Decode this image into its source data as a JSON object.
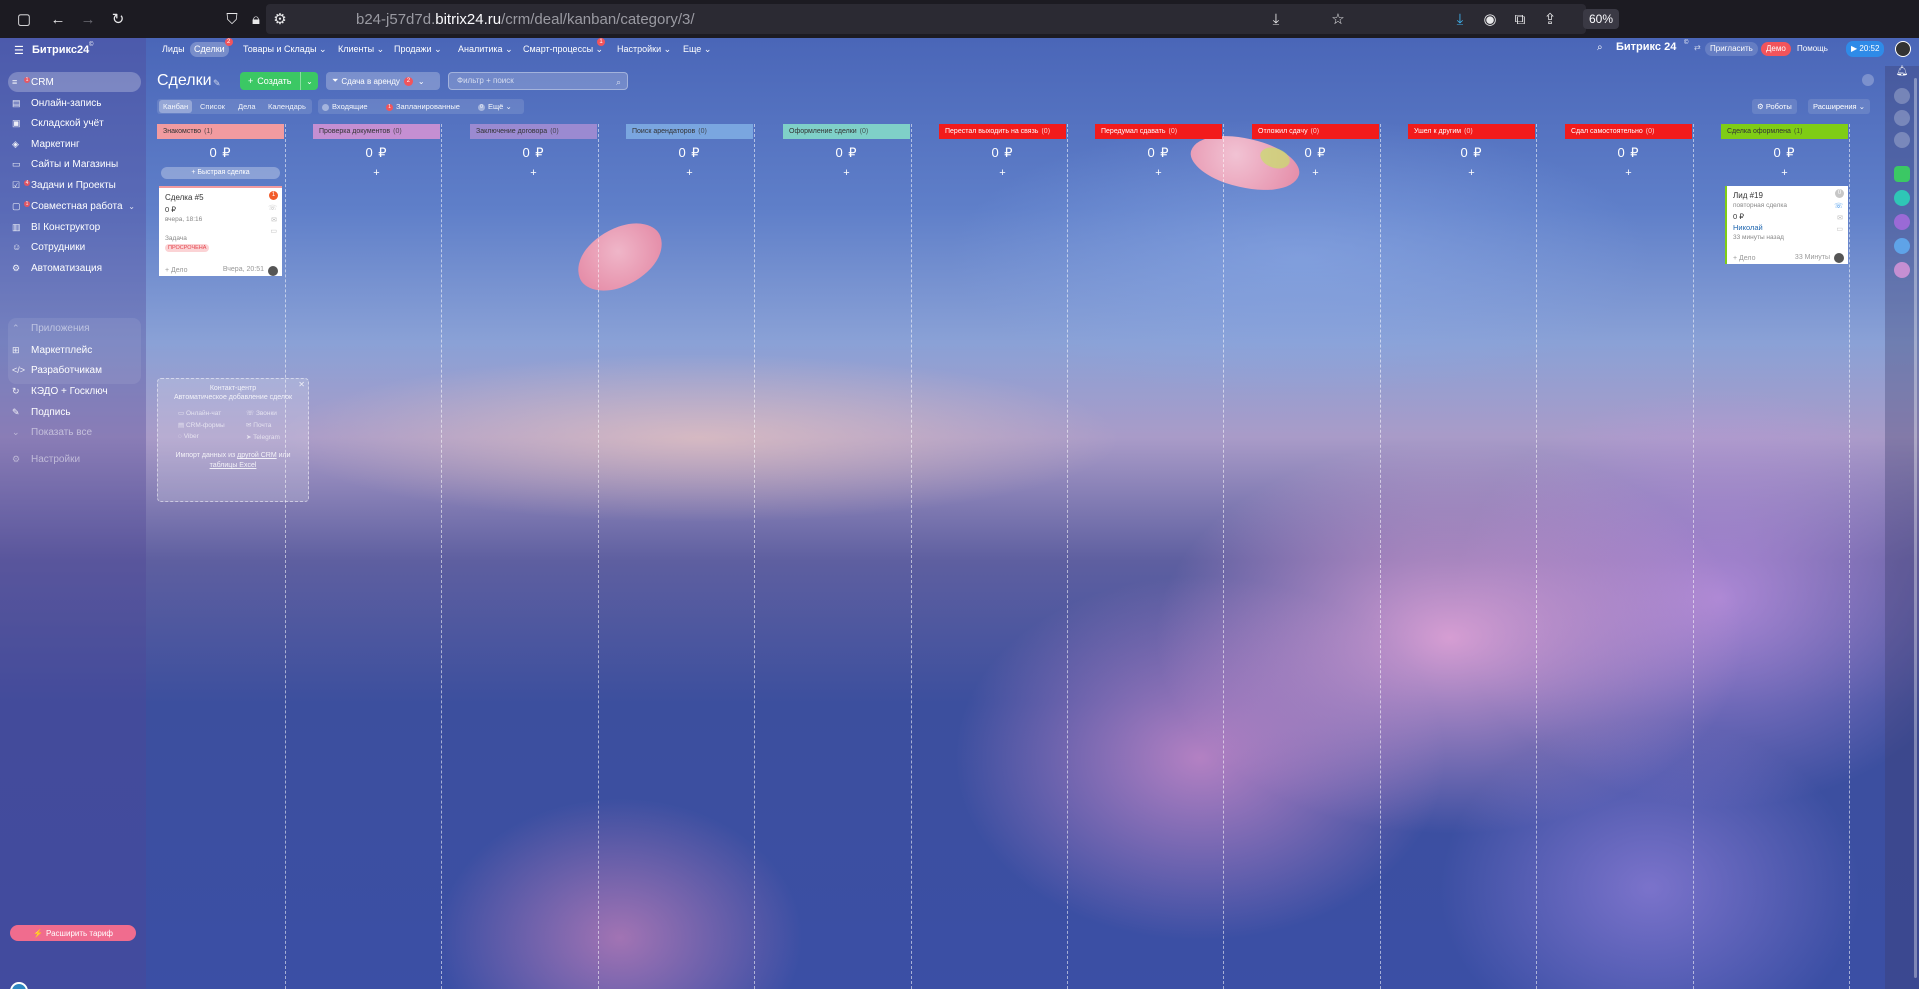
{
  "browser": {
    "url_host": "b24-j57d7d.",
    "url_domain": "bitrix24.ru",
    "url_path": "/crm/deal/kanban/category/3/",
    "zoom": "60%"
  },
  "sidebar": {
    "logo": "Битрикс24",
    "items": [
      {
        "label": "CRM",
        "badge": "1"
      },
      {
        "label": "Онлайн-запись"
      },
      {
        "label": "Складской учёт"
      },
      {
        "label": "Маркетинг"
      },
      {
        "label": "Сайты и Магазины"
      },
      {
        "label": "Задачи и Проекты",
        "badge": "4"
      },
      {
        "label": "Совместная работа",
        "badge": "1"
      },
      {
        "label": "BI Конструктор"
      },
      {
        "label": "Сотрудники"
      },
      {
        "label": "Автоматизация"
      },
      {
        "label": "Приложения"
      },
      {
        "label": "Маркетплейс"
      },
      {
        "label": "Разработчикам"
      },
      {
        "label": "КЭДО + Госключ"
      },
      {
        "label": "Подпись"
      },
      {
        "label": "Показать все"
      },
      {
        "label": "Настройки"
      }
    ],
    "upgrade": "Расширить тариф"
  },
  "topnav": {
    "items": [
      "Лиды",
      "Сделки",
      "Товары и Склады",
      "Клиенты",
      "Продажи",
      "Аналитика",
      "Смарт-процессы",
      "Настройки",
      "Еще"
    ],
    "deals_badge": "2",
    "smart_badge": "1",
    "brand": "Битрикс 24",
    "invite": "Пригласить",
    "demo": "Демо",
    "help": "Помощь",
    "clock": "20:52"
  },
  "toolbar": {
    "title": "Сделки",
    "create": "Создать",
    "pipeline": "Сдача в аренду",
    "pipeline_badge": "2",
    "filter_placeholder": "Фильтр + поиск",
    "views": [
      "Канбан",
      "Список",
      "Дела",
      "Календарь"
    ],
    "counters": {
      "incoming": "Входящие",
      "planned_badge": "1",
      "planned": "Запланированные",
      "more_badge": "0",
      "more": "Ещё"
    },
    "robots": "Роботы",
    "extensions": "Расширения"
  },
  "stages": [
    {
      "name": "Знакомство",
      "count": "(1)",
      "sum": "0 ₽",
      "color": "#f29ba0"
    },
    {
      "name": "Проверка документов",
      "count": "(0)",
      "sum": "0 ₽",
      "color": "#c58fd2"
    },
    {
      "name": "Заключение договора",
      "count": "(0)",
      "sum": "0 ₽",
      "color": "#9b8ad1"
    },
    {
      "name": "Поиск арендаторов",
      "count": "(0)",
      "sum": "0 ₽",
      "color": "#7aa6e0"
    },
    {
      "name": "Оформление сделки",
      "count": "(0)",
      "sum": "0 ₽",
      "color": "#7fd0c8"
    },
    {
      "name": "Перестал выходить на связь",
      "count": "(0)",
      "sum": "0 ₽",
      "color": "#f21b1b"
    },
    {
      "name": "Передумал сдавать",
      "count": "(0)",
      "sum": "0 ₽",
      "color": "#f21b1b"
    },
    {
      "name": "Отложил сдачу",
      "count": "(0)",
      "sum": "0 ₽",
      "color": "#f21b1b"
    },
    {
      "name": "Ушел к другим",
      "count": "(0)",
      "sum": "0 ₽",
      "color": "#f21b1b"
    },
    {
      "name": "Сдал самостоятельно",
      "count": "(0)",
      "sum": "0 ₽",
      "color": "#f21b1b"
    },
    {
      "name": "Сделка оформлена",
      "count": "(1)",
      "sum": "0 ₽",
      "color": "#7fcd15"
    }
  ],
  "quick_deal": "Быстрая сделка",
  "card1": {
    "title": "Сделка #5",
    "badge": "1",
    "amount": "0 ₽",
    "date": "вчера, 18:16",
    "task_label": "Задача",
    "tag": "ПРОСРОЧЕНА",
    "add": "+ Дело",
    "time": "Вчера, 20:51"
  },
  "card2": {
    "title": "Лид #19",
    "badge": "0",
    "subtitle": "повторная сделка",
    "amount": "0 ₽",
    "contact": "Николай",
    "ago": "33 минуты назад",
    "add": "+ Дело",
    "time": "33 Минуты"
  },
  "contact_center": {
    "title": "Контакт-центр",
    "subtitle": "Автоматическое добавление сделок",
    "channels": [
      "Онлайн-чат",
      "Звонки",
      "CRM-формы",
      "Почта",
      "Viber",
      "Telegram"
    ],
    "import_prefix": "Импорт данных из",
    "import_link1": "другой CRM",
    "import_mid": "или",
    "import_link2": "таблицы Excel"
  }
}
